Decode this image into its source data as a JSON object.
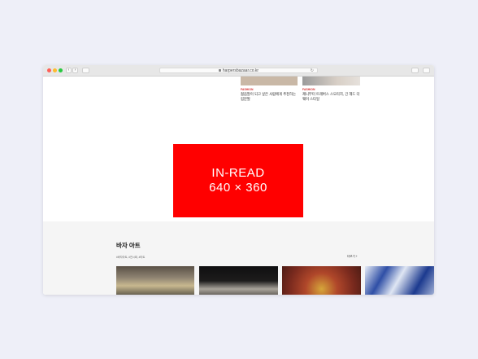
{
  "browser": {
    "url": "harpersbazaar.co.kr",
    "back_glyph": "‹",
    "forward_glyph": "›",
    "reload_glyph": "↻"
  },
  "articles": [
    {
      "category": "FASHION",
      "headline": "젊음말이 되고 싶은 사람에게 추천하는 립분발"
    },
    {
      "category": "FASHION",
      "headline": "제니부터 트레버스 스모리치, 긴 헤드 더 웨이 스타일"
    }
  ],
  "ad": {
    "line1": "IN-READ",
    "line2": "640 × 360"
  },
  "art_section": {
    "title": "바자 아트",
    "tags": "#바자아트, #전시회, #아트",
    "more": "더보기 +"
  },
  "colors": {
    "ad_red": "#ff0000",
    "category_red": "#d01c1c",
    "section_bg": "#f5f5f5"
  }
}
